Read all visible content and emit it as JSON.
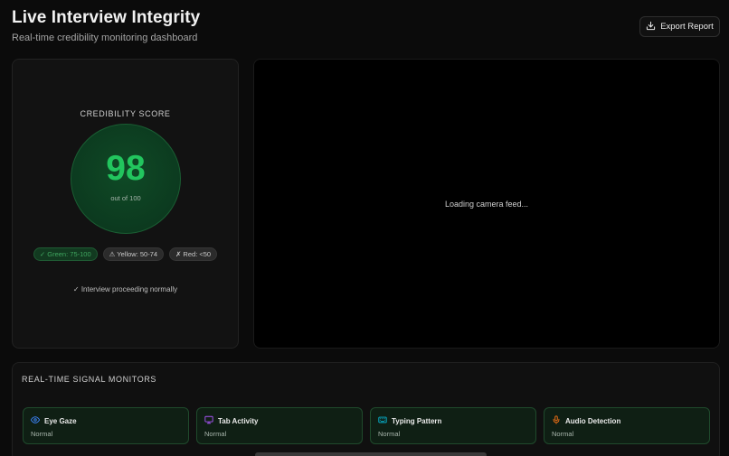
{
  "header": {
    "title": "Live Interview Integrity",
    "subtitle": "Real-time credibility monitoring dashboard",
    "export_label": "Export Report"
  },
  "score": {
    "title": "CREDIBILITY SCORE",
    "value": "98",
    "out_of": "out of 100",
    "badges": {
      "green": "✓ Green: 75-100",
      "yellow": "⚠ Yellow: 50-74",
      "red": "✗ Red: <50"
    },
    "status": "✓ Interview proceeding normally"
  },
  "camera": {
    "loading_text": "Loading camera feed..."
  },
  "monitors": {
    "title": "REAL-TIME SIGNAL MONITORS",
    "items": [
      {
        "label": "Eye Gaze",
        "status": "Normal",
        "icon": "eye-icon",
        "icon_color": "#3b82f6"
      },
      {
        "label": "Tab Activity",
        "status": "Normal",
        "icon": "monitor-icon",
        "icon_color": "#a855f7"
      },
      {
        "label": "Typing Pattern",
        "status": "Normal",
        "icon": "keyboard-icon",
        "icon_color": "#06b6d4"
      },
      {
        "label": "Audio Detection",
        "status": "Normal",
        "icon": "microphone-icon",
        "icon_color": "#f97316"
      }
    ]
  },
  "colors": {
    "accent_green": "#22c55e",
    "background": "#0b0b0b"
  }
}
